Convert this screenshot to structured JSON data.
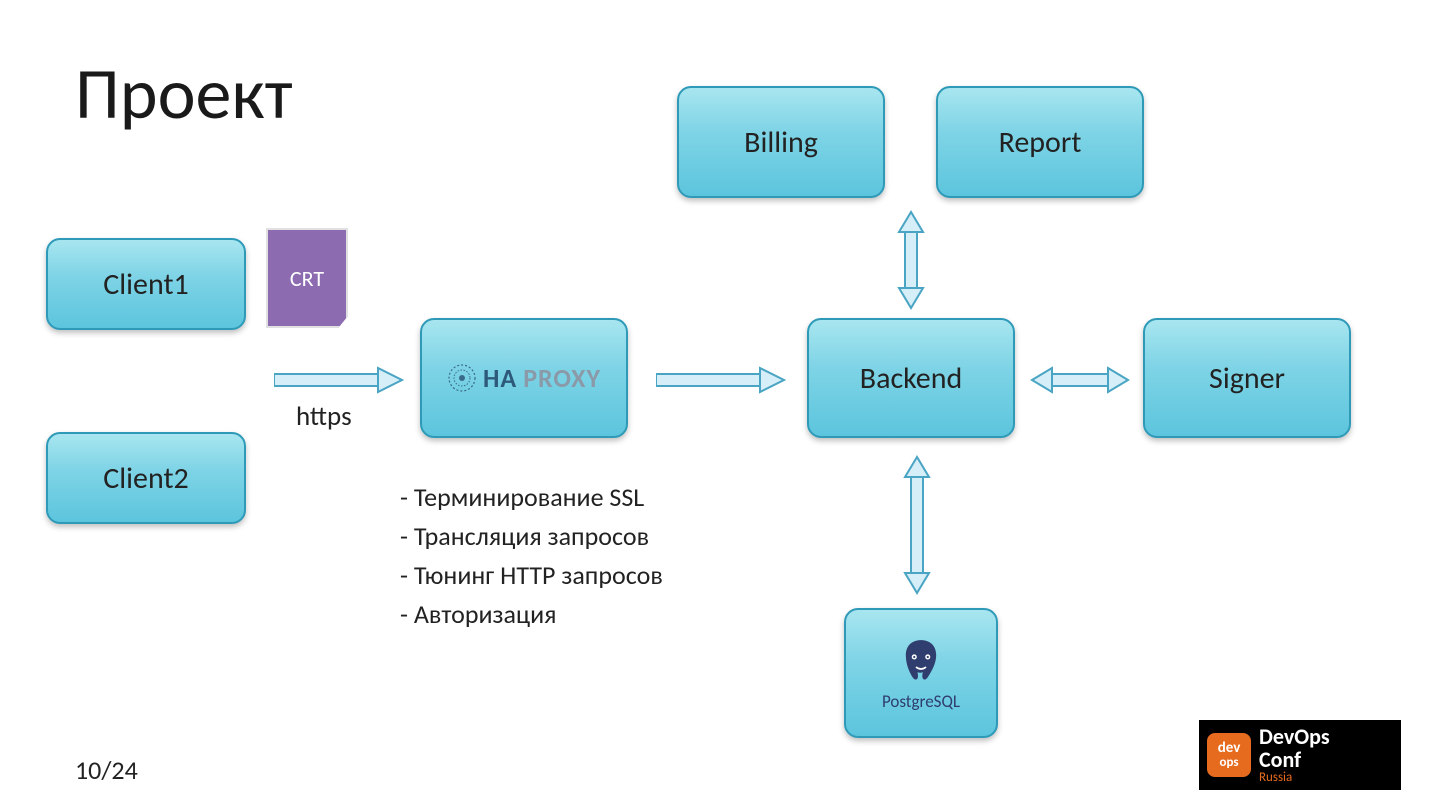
{
  "title": "Проект",
  "crt_label": "CRT",
  "https_label": "https",
  "boxes": {
    "client1": "Client1",
    "client2": "Client2",
    "billing": "Billing",
    "report": "Report",
    "backend": "Backend",
    "signer": "Signer",
    "haproxy_ha": "HA",
    "haproxy_proxy": "PROXY",
    "postgres": "PostgreSQL"
  },
  "bullets": {
    "b1": "Терминирование SSL",
    "b2": "Трансляция запросов",
    "b3": "Тюнинг HTTP запросов",
    "b4": "Авторизация"
  },
  "page_number": "10/24",
  "logo": {
    "dev_top": "dev",
    "dev_bot": "ops",
    "line1": "DevOps",
    "line2": "Conf",
    "line3": "Russia"
  }
}
